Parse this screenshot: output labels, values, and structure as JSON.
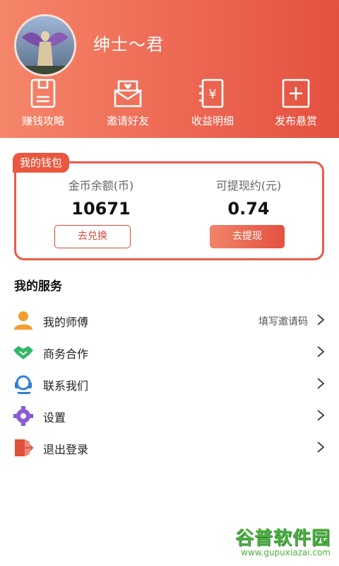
{
  "profile": {
    "username": "绅士～君"
  },
  "quick_actions": [
    {
      "label": "赚钱攻略",
      "icon": "guide-icon"
    },
    {
      "label": "邀请好友",
      "icon": "invite-icon"
    },
    {
      "label": "收益明细",
      "icon": "income-icon"
    },
    {
      "label": "发布悬赏",
      "icon": "publish-icon"
    }
  ],
  "wallet": {
    "tag": "我的钱包",
    "coins_label": "金币余额(币)",
    "coins_value": "10671",
    "cash_label": "可提现约(元)",
    "cash_value": "0.74",
    "exchange_button": "去兑换",
    "withdraw_button": "去提现"
  },
  "services": {
    "title": "我的服务",
    "items": [
      {
        "label": "我的师傅",
        "extra": "填写邀请码",
        "icon": "person-icon",
        "color": "#f0a030"
      },
      {
        "label": "商务合作",
        "extra": "",
        "icon": "handshake-icon",
        "color": "#33b86a"
      },
      {
        "label": "联系我们",
        "extra": "",
        "icon": "headset-icon",
        "color": "#2f7fd6"
      },
      {
        "label": "设置",
        "extra": "",
        "icon": "gear-icon",
        "color": "#8b5cd6"
      },
      {
        "label": "退出登录",
        "extra": "",
        "icon": "logout-icon",
        "color": "#e0523e"
      }
    ]
  },
  "watermark": {
    "brand": "谷普软件园",
    "url": "www.gupuxiazai.com"
  },
  "colors": {
    "accent": "#e9573f",
    "header_start": "#f5866a",
    "header_end": "#e4513f"
  }
}
